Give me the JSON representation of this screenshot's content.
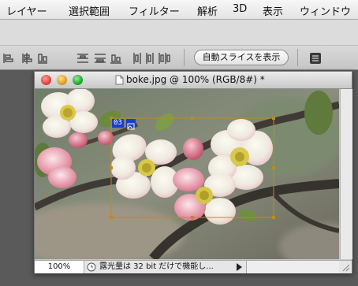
{
  "menu": [
    "レイヤー",
    "選択範囲",
    "フィルター",
    "解析",
    "3D",
    "表示",
    "ウィンドウ"
  ],
  "options": {
    "auto_slice_label": "自動スライスを表示"
  },
  "document": {
    "title": "boke.jpg @ 100% (RGB/8#) *",
    "slice_badge": "03",
    "zoom": "100%",
    "status": "露光量は 32 bit だけで機能し..."
  },
  "colors": {
    "slice_border": "#c08a1a",
    "close": "#e0443e",
    "minimize": "#dea123",
    "zoom": "#1aab29"
  }
}
